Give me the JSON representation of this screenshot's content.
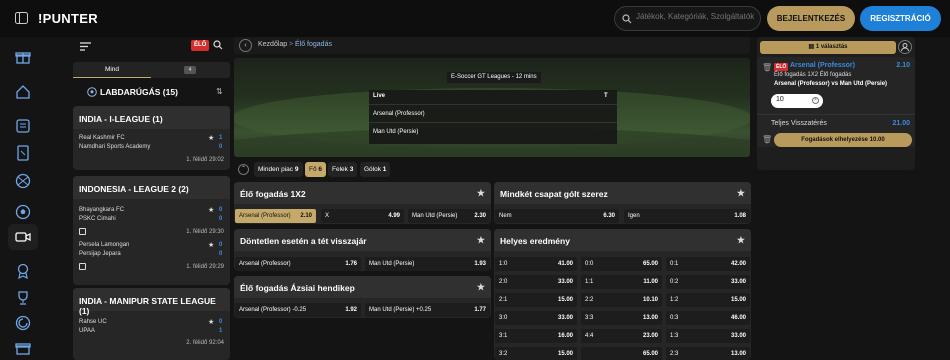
{
  "brand": {
    "logo": "!PUNTER"
  },
  "header": {
    "search_placeholder": "Játékok, Kategóriák, Szolgáltatók",
    "login_label": "BEJELENTKEZÉS",
    "register_label": "REGISZTRÁCIÓ"
  },
  "left": {
    "live_badge": "ÉLŐ",
    "tab_all": "Mind",
    "tab_count": "4",
    "sport_title": "LABDARÚGÁS (15)",
    "leagues": [
      {
        "title": "INDIA - I-LEAGUE (1)",
        "matches": [
          {
            "home": "Real Kashmir FC",
            "away": "Namdhari Sports Academy",
            "home_score": "1",
            "away_score": "0",
            "time": "1. félidő 29:02"
          }
        ]
      },
      {
        "title": "INDONESIA - LEAGUE 2 (2)",
        "matches": [
          {
            "home": "Bhayangkara FC",
            "away": "PSKC Cimahi",
            "home_score": "0",
            "away_score": "0",
            "time": "1. félidő 29:30"
          },
          {
            "home": "Persela Lamongan",
            "away": "Persijap Jepara",
            "home_score": "0",
            "away_score": "0",
            "time": "1. félidő 29:29"
          }
        ]
      },
      {
        "title": "INDIA - MANIPUR STATE LEAGUE (1)",
        "matches": [
          {
            "home": "Rahse UC",
            "away": "UPAA",
            "home_score": "0",
            "away_score": "1",
            "time": "2. félidő 92:04"
          }
        ]
      }
    ]
  },
  "breadcrumb": {
    "home": "Kezdőlap",
    "sep": ">",
    "current": "Élő fogadás"
  },
  "hero": {
    "league": "E-Soccer GT Leagues - 12 mins",
    "live_label": "Live",
    "col_t": "T",
    "teams": [
      "Arsenal (Professor)",
      "Man Utd (Persie)"
    ]
  },
  "chips": [
    {
      "label": "Minden piac",
      "count": "9"
    },
    {
      "label": "Fő",
      "count": "6"
    },
    {
      "label": "Felek",
      "count": "3"
    },
    {
      "label": "Gólok",
      "count": "1"
    }
  ],
  "markets": {
    "m1x2": {
      "title": "Élő fogadás 1X2",
      "cells": [
        {
          "label": "Arsenal (Professor)",
          "odd": "2.10"
        },
        {
          "label": "X",
          "odd": "4.99"
        },
        {
          "label": "Man Utd (Persie)",
          "odd": "2.30"
        }
      ]
    },
    "dnb": {
      "title": "Döntetlen esetén a tét visszajár",
      "cells": [
        {
          "label": "Arsenal (Professor)",
          "odd": "1.76"
        },
        {
          "label": "Man Utd (Persie)",
          "odd": "1.93"
        }
      ]
    },
    "ah": {
      "title": "Élő fogadás Ázsiai hendikep",
      "cells": [
        {
          "label": "Arsenal (Professor) -0.25",
          "odd": "1.92"
        },
        {
          "label": "Man Utd (Persie) +0.25",
          "odd": "1.77"
        }
      ]
    },
    "btts": {
      "title": "Mindkét csapat gólt szerez",
      "cells": [
        {
          "label": "Nem",
          "odd": "6.30"
        },
        {
          "label": "Igen",
          "odd": "1.08"
        }
      ]
    },
    "cs": {
      "title": "Helyes eredmény",
      "rows": [
        [
          {
            "label": "1:0",
            "odd": "41.00"
          },
          {
            "label": "0:0",
            "odd": "65.00"
          },
          {
            "label": "0:1",
            "odd": "42.00"
          }
        ],
        [
          {
            "label": "2:0",
            "odd": "33.00"
          },
          {
            "label": "1:1",
            "odd": "11.00"
          },
          {
            "label": "0:2",
            "odd": "33.00"
          }
        ],
        [
          {
            "label": "2:1",
            "odd": "15.00"
          },
          {
            "label": "2:2",
            "odd": "10.10"
          },
          {
            "label": "1:2",
            "odd": "15.00"
          }
        ],
        [
          {
            "label": "3:0",
            "odd": "33.00"
          },
          {
            "label": "3:3",
            "odd": "13.00"
          },
          {
            "label": "0:3",
            "odd": "46.00"
          }
        ],
        [
          {
            "label": "3:1",
            "odd": "16.00"
          },
          {
            "label": "4:4",
            "odd": "23.00"
          },
          {
            "label": "1:3",
            "odd": "33.00"
          }
        ],
        [
          {
            "label": "3:2",
            "odd": "15.00"
          },
          {
            "label": "",
            "odd": "65.00"
          },
          {
            "label": "2:3",
            "odd": "13.00"
          }
        ]
      ]
    }
  },
  "betslip": {
    "tab_label": "1 választás",
    "live_badge": "ÉLŐ",
    "selection": "Arsenal (Professor)",
    "odd": "2.10",
    "market": "Élő fogadás 1X2 Élő fogadás",
    "event": "Arsenal (Professor) vs Man Utd (Persie)",
    "stake": "10",
    "total_label": "Teljes Visszatérés",
    "total_value": "21.00",
    "place_label": "Fogadások elhelyezése 10.00"
  },
  "colors": {
    "accent": "#c4a96a",
    "brand_blue": "#1f80d8",
    "live_red": "#d32f2f"
  }
}
